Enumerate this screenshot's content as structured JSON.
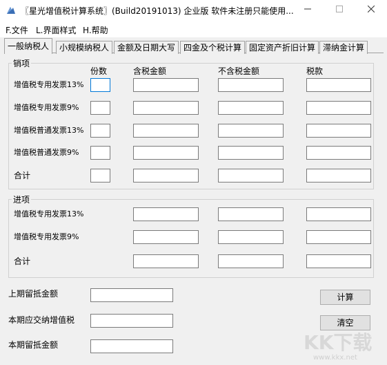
{
  "window": {
    "title": "〖星光增值税计算系统〗(Build20191013) 企业版 软件未注册只能使用..."
  },
  "menu": [
    "F.文件",
    "L.界面样式",
    "H.帮助"
  ],
  "tabs": [
    "一般纳税人",
    "小规模纳税人",
    "金额及日期大写",
    "四金及个税计算",
    "固定资产折旧计算",
    "滞纳金计算"
  ],
  "sales": {
    "group_label": "销项",
    "headers": {
      "count": "份数",
      "tax_incl": "含税金额",
      "tax_excl": "不含税金额",
      "tax": "税款"
    },
    "rows": [
      "增值税专用发票13%",
      "增值税专用发票9%",
      "增值税普通发票13%",
      "增值税普通发票9%",
      "合计"
    ]
  },
  "purchase": {
    "group_label": "进项",
    "rows": [
      "增值税专用发票13%",
      "增值税专用发票9%",
      "合计"
    ]
  },
  "bottom": {
    "prev_credit": "上期留抵金额",
    "vat_payable": "本期应交纳增值税",
    "curr_credit": "本期留抵金额"
  },
  "buttons": {
    "calc": "计算",
    "clear": "清空"
  },
  "watermark": {
    "logo": "KK下载",
    "url": "www.kkx.net"
  }
}
